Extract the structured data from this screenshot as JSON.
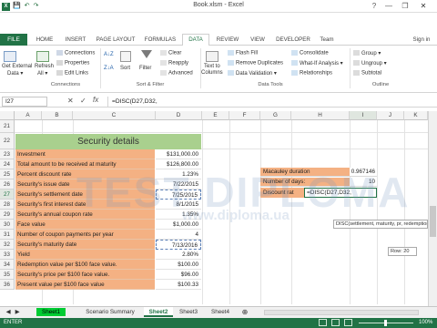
{
  "window": {
    "title": "Book.xlsm - Excel",
    "help": "?",
    "minimize": "—",
    "restore": "❐",
    "close": "✕"
  },
  "qat": {
    "save": "💾",
    "undo": "↶",
    "redo": "↷"
  },
  "tabs": [
    "FILE",
    "HOME",
    "INSERT",
    "PAGE LAYOUT",
    "FORMULAS",
    "DATA",
    "REVIEW",
    "VIEW",
    "DEVELOPER",
    "Team"
  ],
  "signin": "Sign in",
  "ribbon": {
    "get_external": "Get External",
    "get_external2": "Data ▾",
    "refresh": "Refresh",
    "refresh2": "All ▾",
    "connections": "Connections",
    "properties": "Properties",
    "edit_links": "Edit Links",
    "connections_group": "Connections",
    "sort_az": "A↓Z",
    "sort_za": "Z↓A",
    "sort": "Sort",
    "filter": "Filter",
    "clear": "Clear",
    "reapply": "Reapply",
    "advanced": "Advanced",
    "sortfilter_group": "Sort & Filter",
    "text_to_columns": "Text to",
    "text_to_columns2": "Columns",
    "flash_fill": "Flash Fill",
    "remove_duplicates": "Remove Duplicates",
    "data_validation": "Data Validation ▾",
    "consolidate": "Consolidate",
    "what_if": "What-If Analysis ▾",
    "relationships": "Relationships",
    "datatools_group": "Data Tools",
    "group": "Group ▾",
    "ungroup": "Ungroup ▾",
    "subtotal": "Subtotal",
    "outline_group": "Outline"
  },
  "formula_bar": {
    "name_box": "I27",
    "cancel": "✕",
    "enter": "✓",
    "fx": "fx",
    "formula": "=DISC(D27,D32,"
  },
  "columns": [
    "A",
    "B",
    "C",
    "D",
    "E",
    "F",
    "G",
    "H",
    "I",
    "J",
    "K"
  ],
  "rows": [
    {
      "num": "21",
      "label": "",
      "value": ""
    },
    {
      "num": "22",
      "label": "Security details",
      "value": ""
    },
    {
      "num": "23",
      "label": "Investment",
      "value": "$131,000.00"
    },
    {
      "num": "24",
      "label": "Total amount to be received at maturity",
      "value": "$126,800.00"
    },
    {
      "num": "25",
      "label": "Percent discount rate",
      "value": "1.23%"
    },
    {
      "num": "26",
      "label": "Security's issue date",
      "value": "7/22/2015"
    },
    {
      "num": "27",
      "label": "Security's settlement date",
      "value": "7/25/2015"
    },
    {
      "num": "28",
      "label": "Security's first interest date",
      "value": "8/1/2015"
    },
    {
      "num": "29",
      "label": "Security's annual coupon rate",
      "value": "1.35%"
    },
    {
      "num": "30",
      "label": "Face value",
      "value": "$1,000.00"
    },
    {
      "num": "31",
      "label": "Number of coupon payments per year",
      "value": "4"
    },
    {
      "num": "32",
      "label": "Security's maturity date",
      "value": "7/13/2016"
    },
    {
      "num": "33",
      "label": "Yield",
      "value": "2.80%"
    },
    {
      "num": "34",
      "label": "Redemption value per $100 face value.",
      "value": "$100.00"
    },
    {
      "num": "35",
      "label": "Security's price per $100 face value.",
      "value": "$96.00"
    },
    {
      "num": "36",
      "label": "Present value per $100 face value",
      "value": "$100.33"
    }
  ],
  "side": [
    {
      "label": "Macauley duration",
      "value": "0.967146"
    },
    {
      "label": "Number of days:",
      "value": "10"
    },
    {
      "label": "Discount rat",
      "value": "=DISC(D27,D32,"
    }
  ],
  "tooltip": "DISC(settlement, maturity, pr, redemption, [basis])",
  "row_tip": "Row: 20",
  "watermark": {
    "big": "TEST DIPLOMA",
    "small": "www.diploma.ua"
  },
  "sheets": [
    "Sheet1",
    "Scenario Summary",
    "Sheet2",
    "Sheet3",
    "Sheet4"
  ],
  "status": {
    "mode": "ENTER",
    "zoom": "100%"
  },
  "colors": {
    "excel_green": "#217346",
    "label_fill": "#f4b183",
    "header_fill": "#a9d08e",
    "value_fill": "#f4b183"
  }
}
